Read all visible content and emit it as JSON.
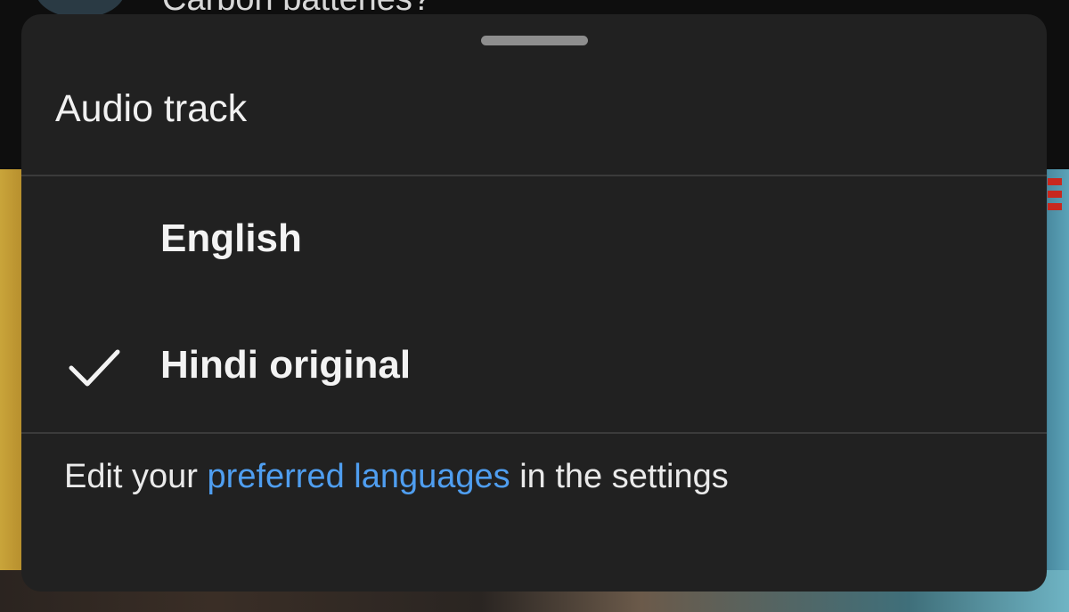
{
  "background": {
    "video_title_partial": "Carbon batteries?"
  },
  "sheet": {
    "title": "Audio track",
    "options": [
      {
        "label": "English",
        "selected": false
      },
      {
        "label": "Hindi original",
        "selected": true
      }
    ],
    "footer": {
      "prefix": "Edit your ",
      "link": "preferred languages",
      "suffix": " in the settings"
    }
  },
  "colors": {
    "sheet_bg": "#212121",
    "link": "#4f9ef0",
    "text": "#f3f3f3"
  },
  "icons": {
    "selected_marker": "checkmark-icon"
  }
}
